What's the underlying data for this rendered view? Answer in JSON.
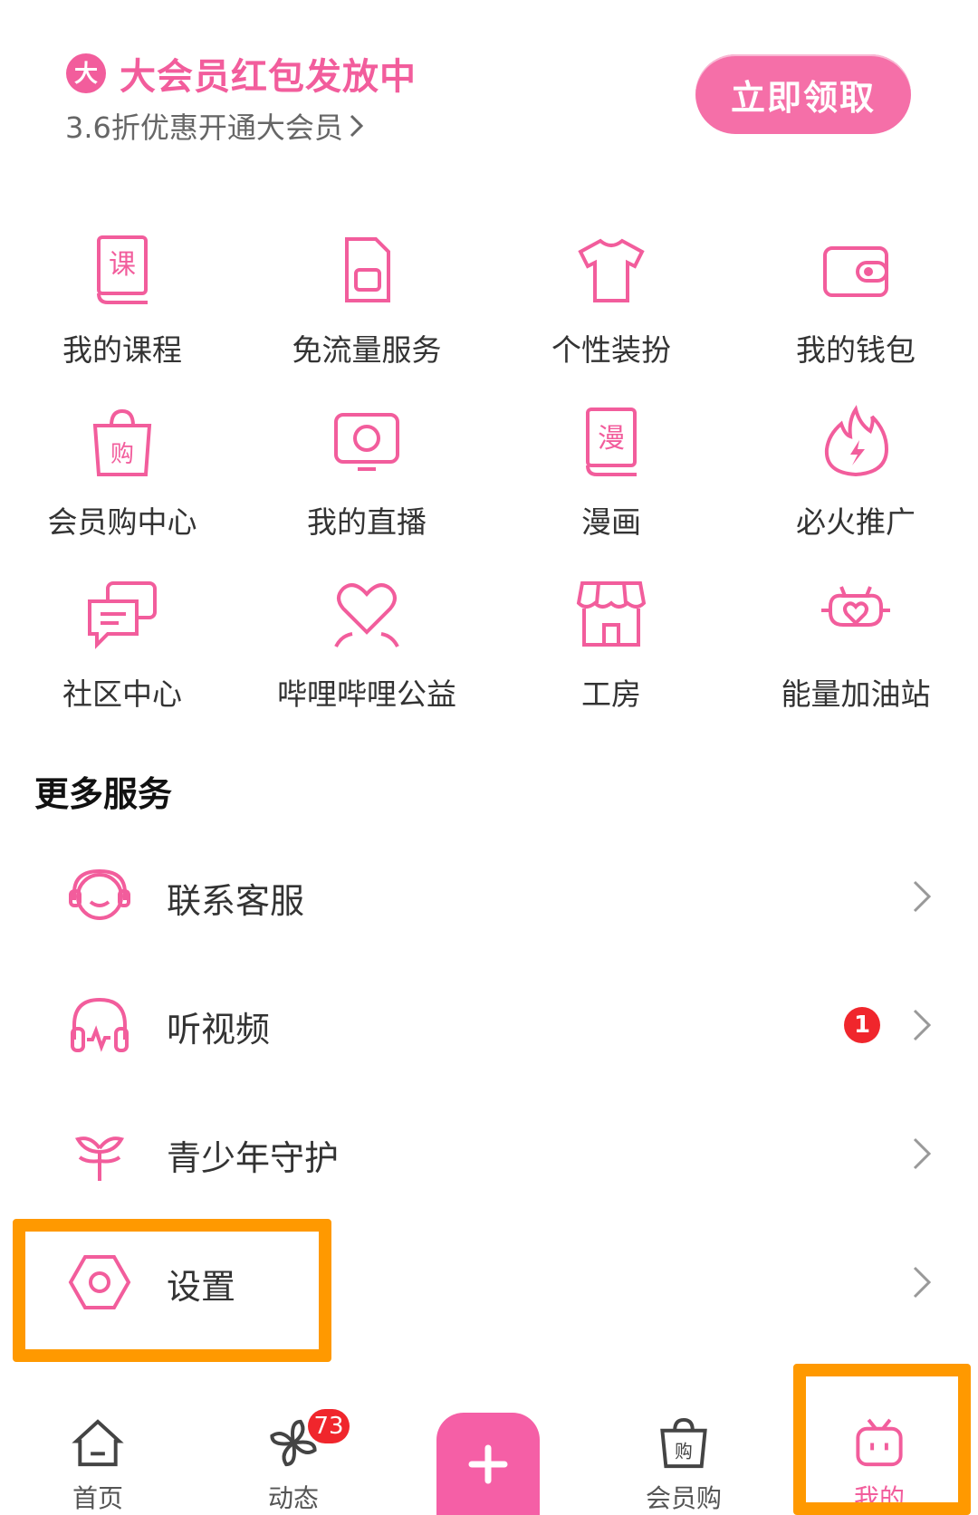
{
  "banner": {
    "icon": "vip-badge-icon",
    "title": "大会员红包发放中",
    "subtitle": "3.6折优惠开通大会员",
    "claim_label": "立即领取"
  },
  "grid": [
    {
      "label": "我的课程",
      "icon": "course-book-icon"
    },
    {
      "label": "免流量服务",
      "icon": "sim-card-icon"
    },
    {
      "label": "个性装扮",
      "icon": "tshirt-icon"
    },
    {
      "label": "我的钱包",
      "icon": "wallet-icon"
    },
    {
      "label": "会员购中心",
      "icon": "shopping-bag-icon"
    },
    {
      "label": "我的直播",
      "icon": "live-tv-icon"
    },
    {
      "label": "漫画",
      "icon": "comic-book-icon"
    },
    {
      "label": "必火推广",
      "icon": "flame-icon"
    },
    {
      "label": "社区中心",
      "icon": "chat-bubbles-icon"
    },
    {
      "label": "哔哩哔哩公益",
      "icon": "heart-hands-icon"
    },
    {
      "label": "工房",
      "icon": "storefront-icon"
    },
    {
      "label": "能量加油站",
      "icon": "energy-heart-icon"
    }
  ],
  "more_services": {
    "title": "更多服务",
    "items": [
      {
        "label": "联系客服",
        "icon": "headset-icon",
        "badge": ""
      },
      {
        "label": "听视频",
        "icon": "headphones-icon",
        "badge": "1"
      },
      {
        "label": "青少年守护",
        "icon": "sprout-icon",
        "badge": ""
      },
      {
        "label": "设置",
        "icon": "settings-hexagon-icon",
        "badge": ""
      }
    ]
  },
  "tabbar": {
    "items": [
      {
        "label": "首页",
        "icon": "home-icon"
      },
      {
        "label": "动态",
        "icon": "pinwheel-icon",
        "badge": "73"
      },
      {
        "label": "会员购",
        "icon": "shopping-bag-icon"
      },
      {
        "label": "我的",
        "icon": "tv-mascot-icon",
        "active": true
      }
    ]
  },
  "colors": {
    "accent": "#f25d9c",
    "highlight": "#ff9900",
    "badge": "#f0262c"
  }
}
